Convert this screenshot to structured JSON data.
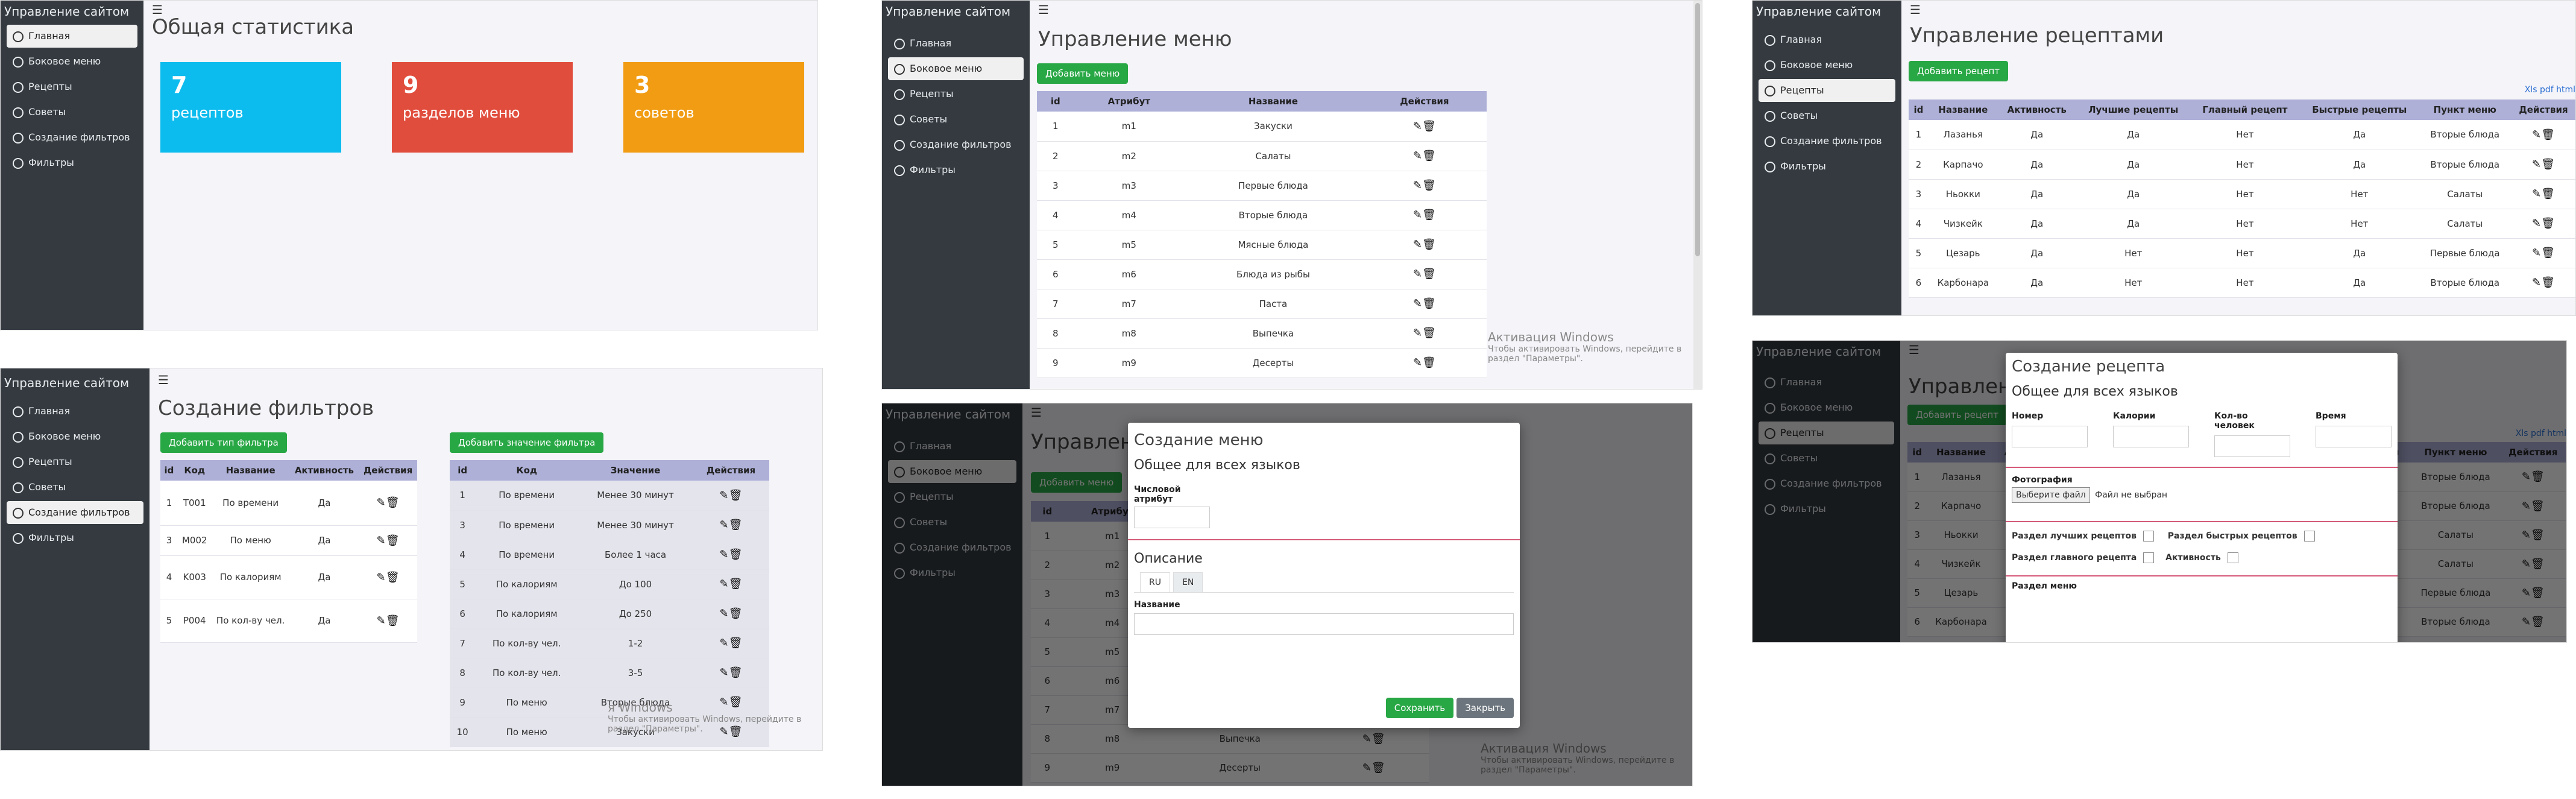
{
  "sidebar": {
    "brand": "Управление сайтом",
    "items": [
      "Главная",
      "Боковое меню",
      "Рецепты",
      "Советы",
      "Создание фильтров",
      "Фильтры"
    ]
  },
  "dashboard": {
    "title": "Общая статистика",
    "cards": [
      {
        "num": "7",
        "label": "рецептов",
        "color": "#0dbcee"
      },
      {
        "num": "9",
        "label": "разделов меню",
        "color": "#e14d3d"
      },
      {
        "num": "3",
        "label": "советов",
        "color": "#f19c13"
      }
    ]
  },
  "menu": {
    "title": "Управление меню",
    "add_button": "Добавить меню",
    "columns": [
      "id",
      "Атрибут",
      "Название",
      "Действия"
    ],
    "rows": [
      [
        "1",
        "m1",
        "Закуски"
      ],
      [
        "2",
        "m2",
        "Салаты"
      ],
      [
        "3",
        "m3",
        "Первые блюда"
      ],
      [
        "4",
        "m4",
        "Вторые блюда"
      ],
      [
        "5",
        "m5",
        "Мясные блюда"
      ],
      [
        "6",
        "m6",
        "Блюда из рыбы"
      ],
      [
        "7",
        "m7",
        "Паста"
      ],
      [
        "8",
        "m8",
        "Выпечка"
      ],
      [
        "9",
        "m9",
        "Десерты"
      ]
    ]
  },
  "recipes": {
    "title": "Управление рецептами",
    "add_button": "Добавить рецепт",
    "xls_link": "Xls pdf html",
    "columns": [
      "id",
      "Название",
      "Активность",
      "Лучшие рецепты",
      "Главный рецепт",
      "Быстрые рецепты",
      "Пункт меню",
      "Действия"
    ],
    "rows": [
      [
        "1",
        "Лазанья",
        "Да",
        "Да",
        "Нет",
        "Да",
        "Вторые блюда"
      ],
      [
        "2",
        "Карпачо",
        "Да",
        "Да",
        "Нет",
        "Да",
        "Вторые блюда"
      ],
      [
        "3",
        "Ньокки",
        "Да",
        "Да",
        "Нет",
        "Нет",
        "Салаты"
      ],
      [
        "4",
        "Чизкейк",
        "Да",
        "Да",
        "Нет",
        "Нет",
        "Салаты"
      ],
      [
        "5",
        "Цезарь",
        "Да",
        "Нет",
        "Нет",
        "Да",
        "Первые блюда"
      ],
      [
        "6",
        "Карбонара",
        "Да",
        "Нет",
        "Нет",
        "Да",
        "Вторые блюда"
      ]
    ]
  },
  "filters": {
    "title": "Создание фильтров",
    "add_type_button": "Добавить тип фильтра",
    "add_value_button": "Добавить значение фильтра",
    "type_columns": [
      "id",
      "Код",
      "Название",
      "Активность",
      "Действия"
    ],
    "type_rows": [
      [
        "1",
        "T001",
        "По времени",
        "Да"
      ],
      [
        "3",
        "M002",
        "По меню",
        "Да"
      ],
      [
        "4",
        "K003",
        "По калориям",
        "Да"
      ],
      [
        "5",
        "P004",
        "По кол-ву чел.",
        "Да"
      ]
    ],
    "value_columns": [
      "id",
      "Код",
      "Значение",
      "Действия"
    ],
    "value_rows": [
      [
        "1",
        "По времени",
        "Менее 30 минут"
      ],
      [
        "3",
        "По времени",
        "Менее 30 минут"
      ],
      [
        "4",
        "По времени",
        "Более 1 часа"
      ],
      [
        "5",
        "По калориям",
        "До 100"
      ],
      [
        "6",
        "По калориям",
        "До 250"
      ],
      [
        "7",
        "По кол-ву чел.",
        "1-2"
      ],
      [
        "8",
        "По кол-ву чел.",
        "3-5"
      ],
      [
        "9",
        "По меню",
        "Вторые блюда"
      ],
      [
        "10",
        "По меню",
        "Закуски"
      ]
    ]
  },
  "menu_modal": {
    "title": "Создание меню",
    "subtitle": "Общее для всех языков",
    "num_attr_label": "Числовой атрибут",
    "desc_title": "Описание",
    "tabs": [
      "RU",
      "EN"
    ],
    "name_label": "Название",
    "save": "Сохранить",
    "close": "Закрыть"
  },
  "recipe_modal": {
    "title": "Создание рецепта",
    "subtitle": "Общее для всех языков",
    "fields": [
      "Номер",
      "Калории",
      "Кол-во человек",
      "Время"
    ],
    "photo_label": "Фотография",
    "file_button": "Выберите файл",
    "file_none": "Файл не выбран",
    "chk_best": "Раздел лучших рецептов",
    "chk_fast": "Раздел быстрых рецептов",
    "chk_main": "Раздел главного рецепта",
    "chk_active": "Активность",
    "menu_section": "Раздел меню"
  },
  "watermark": {
    "title": "Активация Windows",
    "text": "Чтобы активировать Windows, перейдите в раздел \"Параметры\".",
    "title_short": "я Windows",
    "text_short": "Чтобы активировать Windows, перейдите в раздел \"Параметры\"."
  },
  "icons": {
    "menu": "hamburger-icon",
    "edit": "pencil-icon",
    "delete": "trash-icon"
  }
}
